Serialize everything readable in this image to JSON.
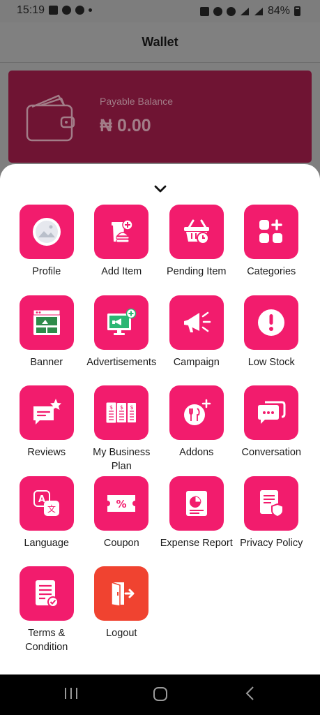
{
  "status_bar": {
    "time": "15:19",
    "battery": "84%"
  },
  "header": {
    "title": "Wallet"
  },
  "balance": {
    "label": "Payable Balance",
    "value": "₦ 0.00"
  },
  "menu": [
    {
      "label": "Profile",
      "icon": "profile-image-icon"
    },
    {
      "label": "Add Item",
      "icon": "add-item-icon"
    },
    {
      "label": "Pending Item",
      "icon": "pending-basket-icon"
    },
    {
      "label": "Categories",
      "icon": "categories-grid-icon"
    },
    {
      "label": "Banner",
      "icon": "banner-icon"
    },
    {
      "label": "Advertisements",
      "icon": "advertisement-icon"
    },
    {
      "label": "Campaign",
      "icon": "megaphone-icon"
    },
    {
      "label": "Low Stock",
      "icon": "exclamation-icon"
    },
    {
      "label": "Reviews",
      "icon": "review-star-icon"
    },
    {
      "label": "My Business Plan",
      "icon": "business-plan-icon"
    },
    {
      "label": "Addons",
      "icon": "addons-icon"
    },
    {
      "label": "Conversation",
      "icon": "chat-bubbles-icon"
    },
    {
      "label": "Language",
      "icon": "translate-icon"
    },
    {
      "label": "Coupon",
      "icon": "coupon-percent-icon"
    },
    {
      "label": "Expense Report",
      "icon": "report-icon"
    },
    {
      "label": "Privacy Policy",
      "icon": "privacy-shield-icon"
    },
    {
      "label": "Terms & Condition",
      "icon": "terms-document-icon"
    },
    {
      "label": "Logout",
      "icon": "logout-door-icon"
    }
  ],
  "colors": {
    "tile": "#f21c6d",
    "logout": "#f04330",
    "card": "#6f1433"
  }
}
